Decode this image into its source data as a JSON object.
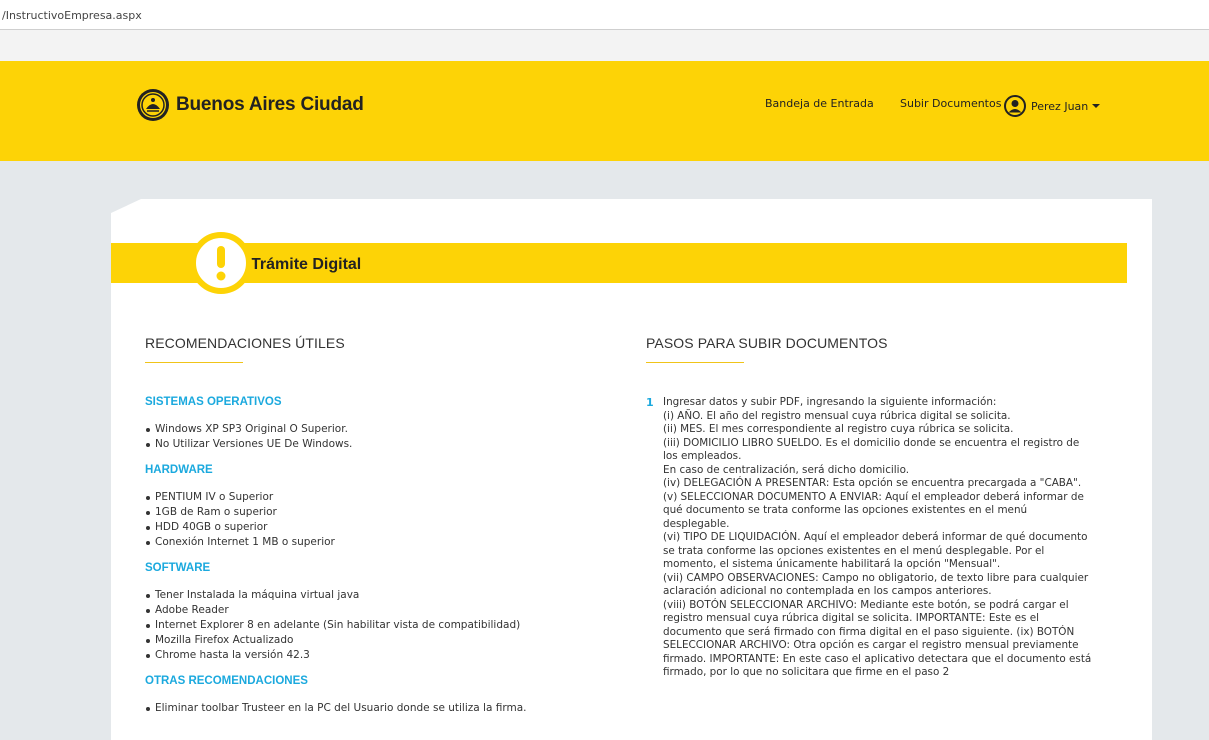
{
  "browser": {
    "url": "/InstructivoEmpresa.aspx"
  },
  "header": {
    "brand": "Buenos Aires Ciudad",
    "nav": {
      "inbox": "Bandeja de Entrada",
      "upload": "Subir Documentos",
      "user": "Perez Juan"
    }
  },
  "banner": {
    "title": "Trámite Digital"
  },
  "recommendations": {
    "title": "RECOMENDACIONES ÚTILES",
    "os": {
      "title": "SISTEMAS OPERATIVOS",
      "items": [
        "Windows XP SP3 Original O Superior.",
        "No Utilizar Versiones UE De Windows."
      ]
    },
    "hardware": {
      "title": "HARDWARE",
      "items": [
        "PENTIUM IV o Superior",
        "1GB de Ram o superior",
        "HDD 40GB o superior",
        "Conexión Internet 1 MB o superior"
      ]
    },
    "software": {
      "title": "SOFTWARE",
      "items": [
        "Tener Instalada la máquina virtual java",
        "Adobe Reader",
        "Internet Explorer 8 en adelante (Sin habilitar vista de compatibilidad)",
        "Mozilla Firefox Actualizado",
        "Chrome hasta la versión 42.3"
      ]
    },
    "other": {
      "title": "OTRAS RECOMENDACIONES",
      "items": [
        "Eliminar toolbar Trusteer en la PC del Usuario donde se utiliza la firma."
      ]
    }
  },
  "steps": {
    "title": "PASOS PARA SUBIR DOCUMENTOS",
    "step1": {
      "number": "1",
      "lines": [
        "Ingresar datos y subir PDF, ingresando la siguiente información:",
        "(i) AÑO. El año del registro mensual cuya rúbrica digital se solicita.",
        "(ii) MES. El mes correspondiente al registro cuya rúbrica se solicita.",
        "(iii) DOMICILIO LIBRO SUELDO. Es el domicilio donde se encuentra el registro de",
        "los empleados.",
        "En caso de centralización, será dicho domicilio.",
        "(iv) DELEGACIÓN A PRESENTAR: Esta opción se encuentra precargada a \"CABA\".",
        "(v) SELECCIONAR DOCUMENTO A ENVIAR: Aquí el empleador deberá informar de",
        "qué documento se trata conforme las opciones existentes en el menú",
        "desplegable.",
        "(vi) TIPO DE LIQUIDACIÓN. Aquí el empleador deberá informar de qué documento",
        "se trata conforme las opciones existentes en el menú desplegable. Por el",
        "momento, el sistema únicamente habilitará la opción \"Mensual\".",
        "(vii) CAMPO OBSERVACIONES: Campo no obligatorio, de texto libre para cualquier",
        "aclaración adicional no contemplada en los campos anteriores.",
        "(viii) BOTÓN SELECCIONAR ARCHIVO: Mediante este botón, se podrá cargar el",
        "registro mensual cuya rúbrica digital se solicita. IMPORTANTE: Este es el",
        "documento que será firmado con firma digital en el paso siguiente. (ix) BOTÓN",
        "SELECCIONAR ARCHIVO: Otra opción es cargar el registro mensual previamente",
        "firmado. IMPORTANTE: En este caso el aplicativo detectara que el documento está",
        "firmado, por lo que no solicitara que firme en el paso 2"
      ]
    }
  },
  "colors": {
    "yellow": "#fdd306",
    "accent": "#1ba9de",
    "background": "#e4e8eb"
  },
  "icons": {
    "seal": "city-seal-icon",
    "user": "user-avatar-icon",
    "alert": "exclamation-icon"
  }
}
